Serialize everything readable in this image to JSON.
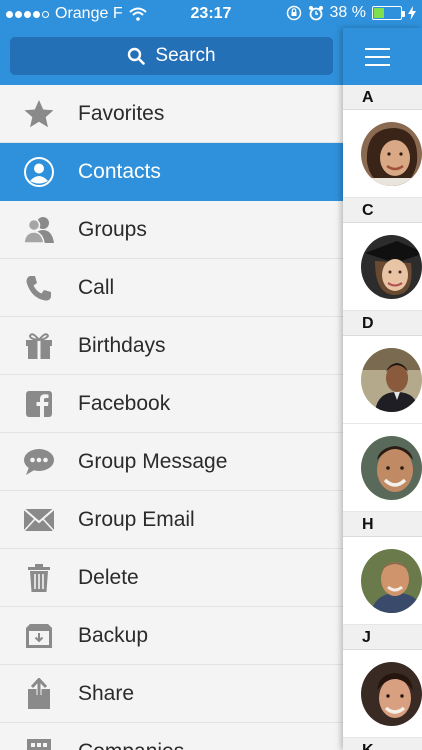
{
  "status_bar": {
    "carrier": "Orange F",
    "time": "23:17",
    "battery": "38 %",
    "battery_level": 0.38
  },
  "search": {
    "label": "Search"
  },
  "menu": [
    {
      "label": "Favorites",
      "icon": "star-icon",
      "active": false
    },
    {
      "label": "Contacts",
      "icon": "user-circle-icon",
      "active": true
    },
    {
      "label": "Groups",
      "icon": "group-icon",
      "active": false
    },
    {
      "label": "Call",
      "icon": "phone-icon",
      "active": false
    },
    {
      "label": "Birthdays",
      "icon": "gift-icon",
      "active": false
    },
    {
      "label": "Facebook",
      "icon": "facebook-icon",
      "active": false
    },
    {
      "label": "Group Message",
      "icon": "chat-bubble-icon",
      "active": false
    },
    {
      "label": "Group Email",
      "icon": "envelope-icon",
      "active": false
    },
    {
      "label": "Delete",
      "icon": "trash-icon",
      "active": false
    },
    {
      "label": "Backup",
      "icon": "backup-icon",
      "active": false
    },
    {
      "label": "Share",
      "icon": "share-icon",
      "active": false
    },
    {
      "label": "Companies",
      "icon": "building-icon",
      "active": false
    }
  ],
  "contact_sections": [
    {
      "letter": "A",
      "count": 1
    },
    {
      "letter": "C",
      "count": 1
    },
    {
      "letter": "D",
      "count": 2
    },
    {
      "letter": "H",
      "count": 1
    },
    {
      "letter": "J",
      "count": 1
    },
    {
      "letter": "K",
      "count": 0
    }
  ],
  "colors": {
    "accent": "#2f91db",
    "search_bar": "#2470b7",
    "icon_gray": "#8a8a8a"
  }
}
